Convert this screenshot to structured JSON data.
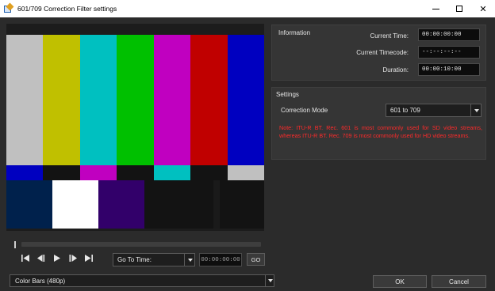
{
  "window": {
    "title": "601/709 Correction Filter settings",
    "icon": "filter-settings-icon",
    "minimize_icon": "minimize-icon",
    "maximize_icon": "maximize-icon",
    "close_symbol": "✕"
  },
  "preview": {
    "top_bars": [
      "#c0c0c0",
      "#c0c000",
      "#00c0c0",
      "#00c000",
      "#c000c0",
      "#c00000",
      "#0000c0"
    ],
    "middle_bars": [
      "#0000c0",
      "#131313",
      "#c000c0",
      "#131313",
      "#00c0c0",
      "#131313",
      "#c0c0c0"
    ],
    "bottom_bars": [
      "#00214c",
      "#ffffff",
      "#32006a",
      "#131313",
      "#131313",
      "#1a1a1a",
      "#131313",
      "#131313"
    ]
  },
  "transport": {
    "buttons": [
      "skip-to-start-icon",
      "step-back-icon",
      "play-icon",
      "step-forward-icon",
      "skip-to-end-icon"
    ],
    "goto_label": "Go To Time:",
    "goto_time": "00:00:00:00",
    "go_label": "GO"
  },
  "source": {
    "selected": "Color Bars (480p)"
  },
  "information": {
    "title": "Information",
    "current_time_label": "Current Time:",
    "current_time_value": "00:00:00:00",
    "current_timecode_label": "Current Timecode:",
    "current_timecode_value": "--:--:--:--",
    "duration_label": "Duration:",
    "duration_value": "00:00:10:00"
  },
  "settings": {
    "title": "Settings",
    "mode_label": "Correction Mode",
    "mode_value": "601 to 709",
    "note": "Note: ITU-R BT. Rec. 601 is most commonly used for SD video streams, whereas ITU-R BT. Rec. 709 is most commonly used for HD video streams."
  },
  "footer": {
    "ok_label": "OK",
    "cancel_label": "Cancel"
  },
  "colors": {
    "note_text": "#ff2a2a",
    "panel_bg": "#353535",
    "window_bg": "#2b2b2b"
  }
}
